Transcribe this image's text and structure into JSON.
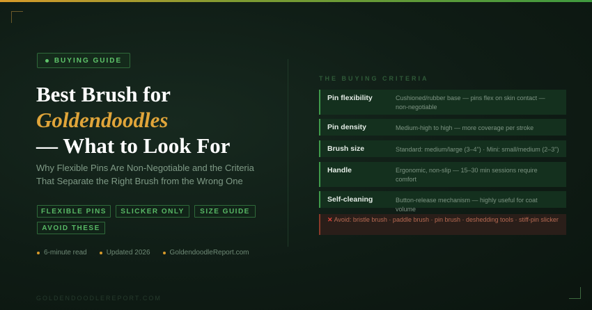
{
  "colors": {
    "accent_gold": "#e0a53a",
    "accent_green": "#5fc46a",
    "avoid_red": "#b86a52",
    "background": "#0f1c15"
  },
  "badge": {
    "label": "BUYING GUIDE"
  },
  "title": {
    "line1": "Best Brush for",
    "line2": "Goldendoodles",
    "line3": "— What to Look For"
  },
  "subtitle": "Why Flexible Pins Are Non-Negotiable and the Criteria That Separate the Right Brush from the Wrong One",
  "tags": [
    "FLEXIBLE PINS",
    "SLICKER ONLY",
    "SIZE GUIDE",
    "AVOID THESE"
  ],
  "meta": [
    "6-minute read",
    "Updated 2026",
    "GoldendoodleReport.com"
  ],
  "footer": "GOLDENDOODLEREPORT.COM",
  "criteria": {
    "heading": "THE BUYING CRITERIA",
    "rows": [
      {
        "name": "Pin flexibility",
        "desc": "Cushioned/rubber base — pins flex on skin contact — non-negotiable"
      },
      {
        "name": "Pin density",
        "desc": "Medium-high to high — more coverage per stroke"
      },
      {
        "name": "Brush size",
        "desc": "Standard: medium/large (3–4\") · Mini: small/medium (2–3\")"
      },
      {
        "name": "Handle",
        "desc": "Ergonomic, non-slip — 15–30 min sessions require comfort"
      },
      {
        "name": "Self-cleaning",
        "desc": "Button-release mechanism — highly useful for coat volume"
      }
    ],
    "avoid_icon": "cross-mark-icon",
    "avoid": "Avoid: bristle brush · paddle brush · pin brush · deshedding tools · stiff-pin slicker"
  }
}
